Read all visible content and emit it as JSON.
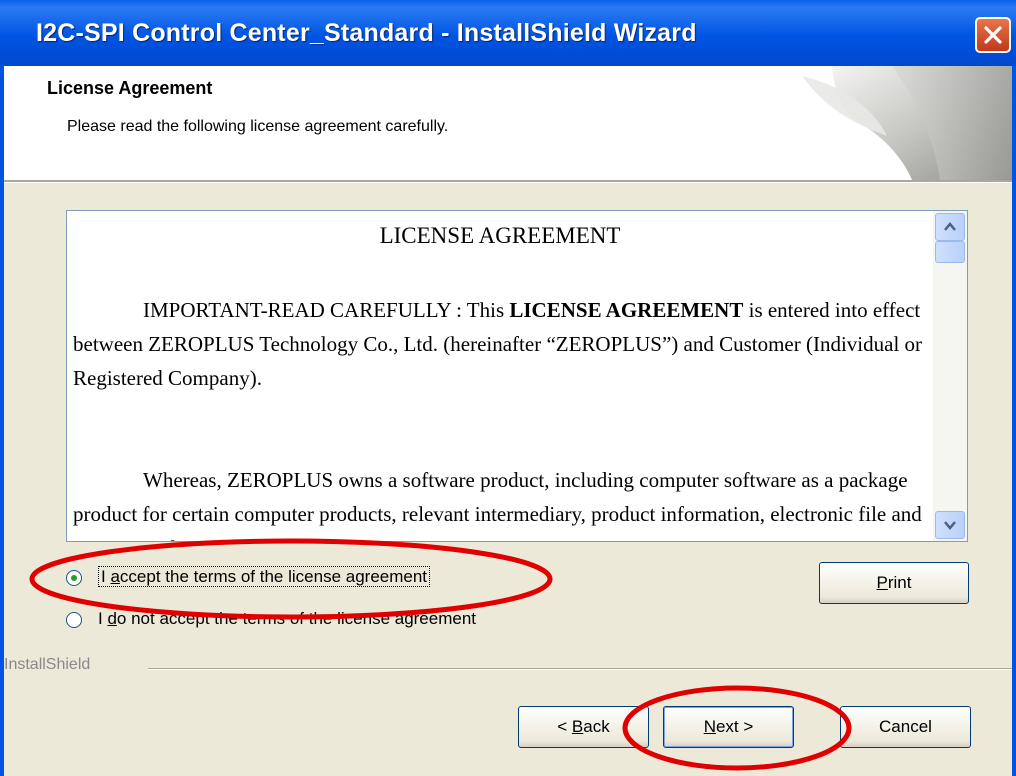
{
  "window": {
    "title": "I2C-SPI Control Center_Standard - InstallShield Wizard"
  },
  "header": {
    "title": "License Agreement",
    "subtitle": "Please read the following license agreement carefully."
  },
  "license": {
    "heading": "LICENSE AGREEMENT",
    "p1_lead": "IMPORTANT-READ CAREFULLY : This ",
    "p1_bold": "LICENSE AGREEMENT",
    "p1_rest": " is entered into effect between ZEROPLUS Technology Co., Ltd. (hereinafter “ZEROPLUS”) and Customer (Individual or Registered Company).",
    "p2": "Whereas, ZEROPLUS owns a software product, including computer software as a package product for certain computer products, relevant intermediary, product information, electronic file and internet on-line"
  },
  "options": {
    "accept_label_pre": "I ",
    "accept_label_mnemonic": "a",
    "accept_label_post": "ccept the terms of the license agreement",
    "accept_selected": true,
    "decline_label_pre": "I ",
    "decline_label_mnemonic": "d",
    "decline_label_post": "o not accept the terms of the license agreement",
    "decline_selected": false
  },
  "buttons": {
    "print_mnemonic": "P",
    "print_rest": "rint",
    "back_pre": "< ",
    "back_mnemonic": "B",
    "back_rest": "ack",
    "next_mnemonic": "N",
    "next_rest": "ext >",
    "cancel": "Cancel"
  },
  "footer": {
    "brand": "InstallShield"
  },
  "colors": {
    "title_bar": "#0054e3",
    "annotation": "#e00000",
    "dialog_bg": "#ece9d8"
  }
}
